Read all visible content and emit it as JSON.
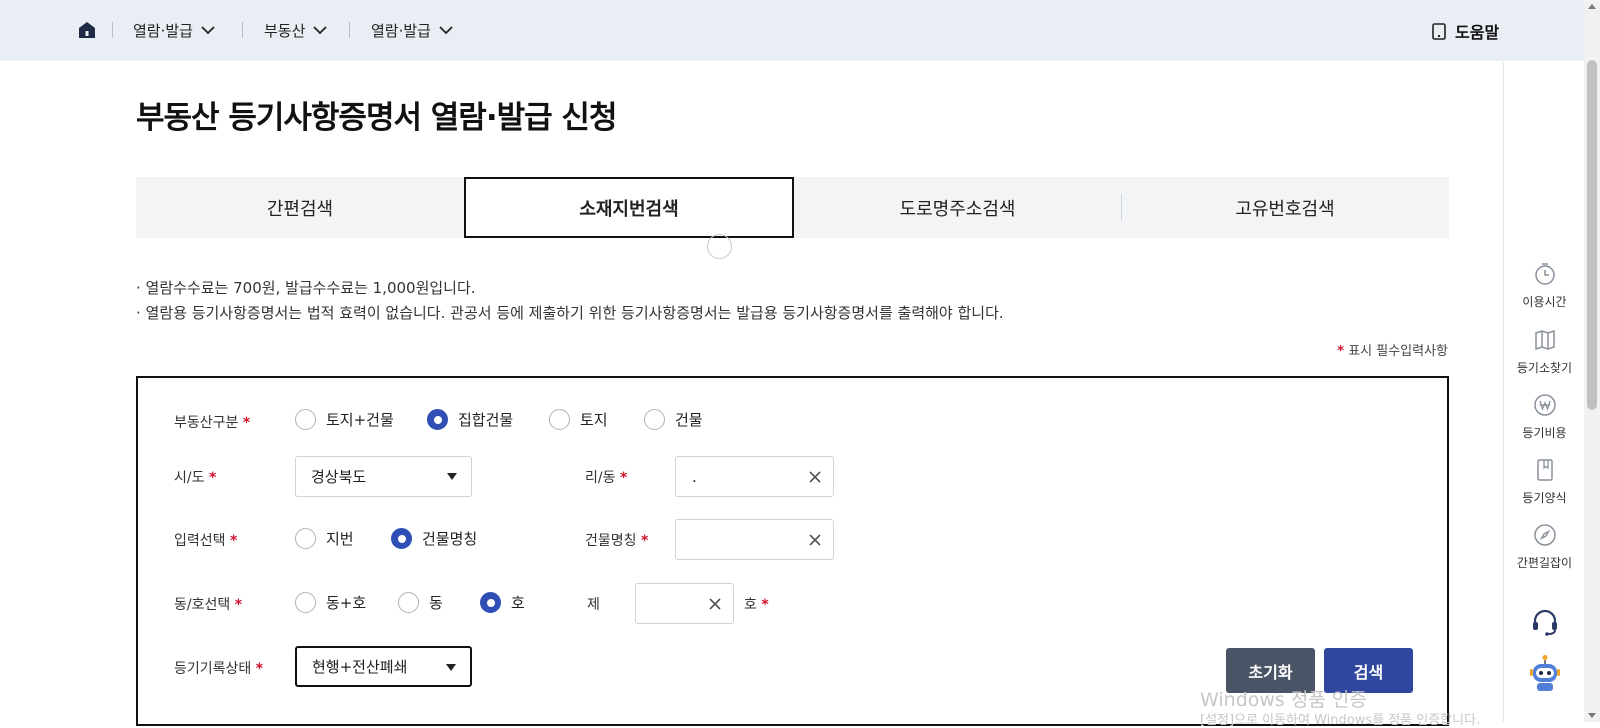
{
  "nav": {
    "menus": [
      {
        "label": "열람·발급"
      },
      {
        "label": "부동산"
      },
      {
        "label": "열람·발급"
      }
    ],
    "help_label": "도움말"
  },
  "page_title": "부동산 등기사항증명서 열람·발급 신청",
  "tabs": [
    {
      "label": "간편검색",
      "active": false
    },
    {
      "label": "소재지번검색",
      "active": true
    },
    {
      "label": "도로명주소검색",
      "active": false
    },
    {
      "label": "고유번호검색",
      "active": false
    }
  ],
  "notices": [
    "· 열람수수료는  700원, 발급수수료는  1,000원입니다.",
    "· 열람용 등기사항증명서는 법적 효력이 없습니다. 관공서 등에 제출하기 위한 등기사항증명서는 발급용 등기사항증명서를 출력해야 합니다."
  ],
  "required_note": {
    "star": "*",
    "text": "표시 필수입력사항"
  },
  "form": {
    "property_type": {
      "label": "부동산구분",
      "options": [
        "토지+건물",
        "집합건물",
        "토지",
        "건물"
      ],
      "selected": "집합건물"
    },
    "sido": {
      "label": "시/도",
      "value": "경상북도"
    },
    "ri_dong": {
      "label": "리/동",
      "value": "."
    },
    "input_select": {
      "label": "입력선택",
      "options": [
        "지번",
        "건물명칭"
      ],
      "selected": "건물명칭"
    },
    "building_name": {
      "label": "건물명칭",
      "value": ""
    },
    "dongho_select": {
      "label": "동/호선택",
      "options": [
        "동+호",
        "동",
        "호"
      ],
      "selected": "호"
    },
    "ho": {
      "prefix": "제",
      "value": "",
      "suffix": "호"
    },
    "record_status": {
      "label": "등기기록상태",
      "value": "현행+전산폐쇄"
    },
    "required_star": "*",
    "reset_label": "초기화",
    "search_label": "검색"
  },
  "quick_menu": [
    {
      "label": "이용시간",
      "icon": "clock-icon"
    },
    {
      "label": "등기소찾기",
      "icon": "map-icon"
    },
    {
      "label": "등기비용",
      "icon": "won-icon"
    },
    {
      "label": "등기양식",
      "icon": "form-icon"
    },
    {
      "label": "간편길잡이",
      "icon": "compass-icon"
    }
  ],
  "watermark": {
    "line1": "Windows 정품 인증",
    "line2": "[설정]으로 이동하여 Windows를 정품 인증합니다."
  },
  "colors": {
    "nav_bg": "#e9edf4",
    "radio_checked": "#2f4fb5",
    "required_star": "#d0112b",
    "reset_button": "#4a5467",
    "search_button": "#2f479e"
  }
}
